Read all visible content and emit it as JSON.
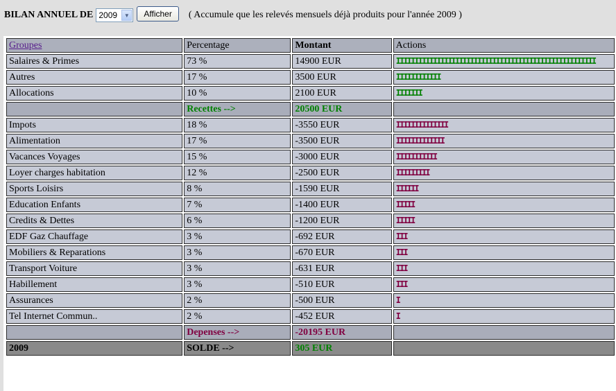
{
  "header": {
    "title": "BILAN ANNUEL DE",
    "year": "2009",
    "button": "Afficher",
    "note": "( Accumule que les relevés mensuels déjà produits pour l'année 2009 )"
  },
  "columns": [
    "Groupes",
    "Percentage",
    "Montant",
    "Actions"
  ],
  "income": [
    {
      "group": "Salaires & Primes",
      "pct": "73 %",
      "amount": "14900 EUR",
      "bar": "IIIIIIIIIIIIIIIIIIIIIIIIIIIIIIIIIIIIIIIIIIIIIIIIIIIIII"
    },
    {
      "group": "Autres",
      "pct": "17 %",
      "amount": "3500 EUR",
      "bar": "IIIIIIIIIIII"
    },
    {
      "group": "Allocations",
      "pct": "10 %",
      "amount": "2100 EUR",
      "bar": "IIIIIII"
    }
  ],
  "income_total": {
    "label": "Recettes -->",
    "amount": "20500 EUR"
  },
  "expenses": [
    {
      "group": "Impots",
      "pct": "18 %",
      "amount": "-3550 EUR",
      "bar": "IIIIIIIIIIIIII"
    },
    {
      "group": "Alimentation",
      "pct": "17 %",
      "amount": "-3500 EUR",
      "bar": "IIIIIIIIIIIII"
    },
    {
      "group": "Vacances Voyages",
      "pct": "15 %",
      "amount": "-3000 EUR",
      "bar": "IIIIIIIIIII"
    },
    {
      "group": "Loyer charges habitation",
      "pct": "12 %",
      "amount": "-2500 EUR",
      "bar": "IIIIIIIII"
    },
    {
      "group": "Sports Loisirs",
      "pct": "8 %",
      "amount": "-1590 EUR",
      "bar": "IIIIII"
    },
    {
      "group": "Education Enfants",
      "pct": "7 %",
      "amount": "-1400 EUR",
      "bar": "IIIII"
    },
    {
      "group": "Credits & Dettes",
      "pct": "6 %",
      "amount": "-1200 EUR",
      "bar": "IIIII"
    },
    {
      "group": "EDF Gaz Chauffage",
      "pct": "3 %",
      "amount": "-692 EUR",
      "bar": "III"
    },
    {
      "group": "Mobiliers & Reparations",
      "pct": "3 %",
      "amount": "-670 EUR",
      "bar": "III"
    },
    {
      "group": "Transport Voiture",
      "pct": "3 %",
      "amount": "-631 EUR",
      "bar": "III"
    },
    {
      "group": "Habillement",
      "pct": "3 %",
      "amount": "-510 EUR",
      "bar": "III"
    },
    {
      "group": "Assurances",
      "pct": "2 %",
      "amount": "-500 EUR",
      "bar": "I"
    },
    {
      "group": "Tel Internet Commun..",
      "pct": "2 %",
      "amount": "-452 EUR",
      "bar": "I"
    }
  ],
  "expenses_total": {
    "label": "Depenses -->",
    "amount": "-20195 EUR"
  },
  "balance": {
    "year": "2009",
    "label": "SOLDE -->",
    "amount": "305 EUR"
  },
  "colors": {
    "income": "#008000",
    "expense": "#800040",
    "link": "#551a8b"
  }
}
